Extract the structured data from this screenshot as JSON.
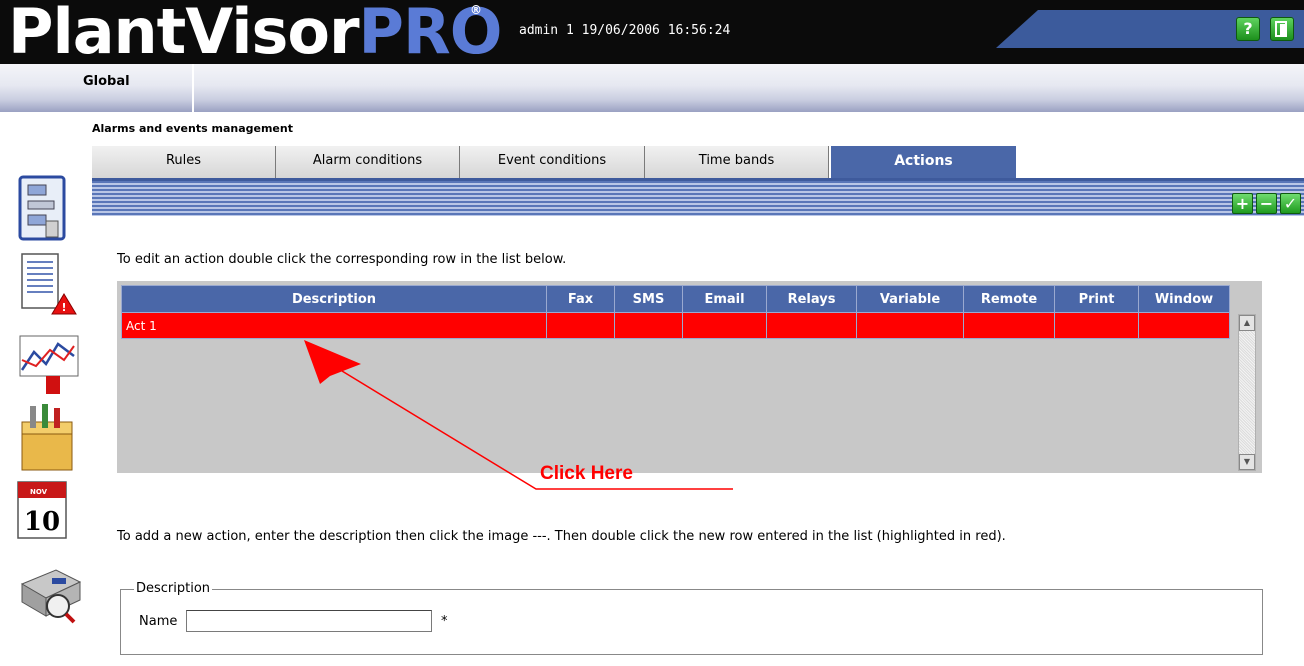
{
  "header": {
    "logo_part1": "PlantVisor",
    "logo_part2": "PRO",
    "logo_reg": "®",
    "user_info": "admin 1 19/06/2006 16:56:24",
    "help_icon": "help-icon",
    "logout_icon": "logout-icon"
  },
  "nav": {
    "global_label": "Global"
  },
  "sidebar": {
    "icons": [
      "site-map-icon",
      "alarm-log-icon",
      "graph-icon",
      "tools-box-icon",
      "calendar-icon",
      "plant-view-icon"
    ],
    "calendar_month": "NOV",
    "calendar_day": "10"
  },
  "page": {
    "section_title": "Alarms and events management",
    "tabs": [
      {
        "label": "Rules"
      },
      {
        "label": "Alarm conditions"
      },
      {
        "label": "Event conditions"
      },
      {
        "label": "Time bands"
      },
      {
        "label": "Actions"
      }
    ],
    "active_tab": "Actions"
  },
  "toolbar": {
    "add_icon": "add-icon",
    "remove_icon": "remove-icon",
    "confirm_icon": "check-icon"
  },
  "instructions": {
    "edit": "To edit an action double click the corresponding row in the list below.",
    "add": "To add a new action, enter the description then click the image ---. Then double click the new row entered in the list (highlighted in red)."
  },
  "table": {
    "columns": [
      "Description",
      "Fax",
      "SMS",
      "Email",
      "Relays",
      "Variable",
      "Remote",
      "Print",
      "Window"
    ],
    "rows": [
      [
        "Act 1",
        "",
        "",
        "",
        "",
        "",
        "",
        "",
        ""
      ]
    ]
  },
  "annotation": {
    "text": "Click Here",
    "color": "#ff0000"
  },
  "form": {
    "legend": "Description",
    "name_label": "Name",
    "name_value": "",
    "required_mark": "*"
  },
  "colors": {
    "header_bg": "#0b0b0b",
    "accent_blue": "#4a67a8",
    "highlight_row": "#ff0000"
  }
}
